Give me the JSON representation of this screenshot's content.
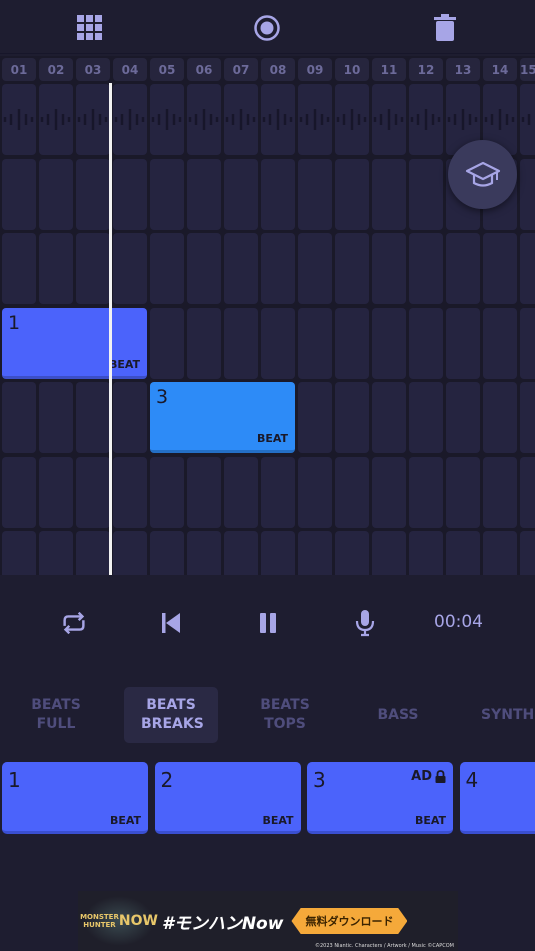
{
  "toolbar": {
    "icons": [
      "grid-icon",
      "record-icon",
      "trash-icon"
    ]
  },
  "timeline": {
    "columns": [
      "01",
      "02",
      "03",
      "04",
      "05",
      "06",
      "07",
      "08",
      "09",
      "10",
      "11",
      "12",
      "13",
      "14",
      "15"
    ]
  },
  "blocks": [
    {
      "number": "1",
      "tag": "BEAT",
      "color": "#4b63fb"
    },
    {
      "number": "3",
      "tag": "BEAT",
      "color": "#2d8bf7"
    }
  ],
  "transport": {
    "time": "00:04"
  },
  "tabs": [
    {
      "label": "BEATS FULL"
    },
    {
      "label": "BEATS BREAKS",
      "active": true
    },
    {
      "label": "BEATS TOPS"
    },
    {
      "label": "BASS"
    },
    {
      "label": "SYNTH"
    }
  ],
  "pads": [
    {
      "number": "1",
      "tag": "BEAT"
    },
    {
      "number": "2",
      "tag": "BEAT"
    },
    {
      "number": "3",
      "tag": "BEAT",
      "badge": "AD"
    },
    {
      "number": "4"
    }
  ],
  "ad": {
    "logo": "MONSTER HUNTER NOW",
    "headline": "#モンハンNow",
    "button": "無料ダウンロード",
    "copyright": "©2023 Niantic. Characters / Artwork / Music ©CAPCOM"
  },
  "colors": {
    "accent": "#a7a5e6",
    "pad": "#4b63fb",
    "pad_alt": "#2d8bf7",
    "background": "#1e1d30"
  }
}
